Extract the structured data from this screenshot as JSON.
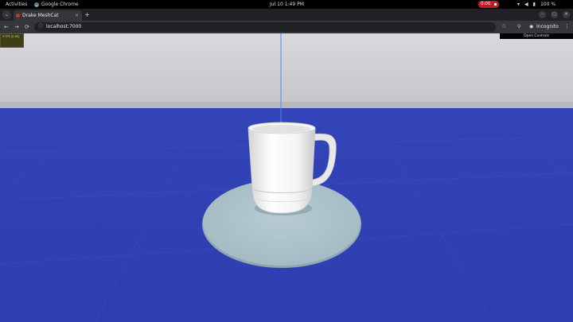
{
  "system_bar": {
    "activities": "Activities",
    "app_name": "Google Chrome",
    "clock": "Jul 10  1:49 PM",
    "recording_time": "0:00",
    "battery": "100 %"
  },
  "browser": {
    "tab_title": "Drake MeshCat",
    "url": "localhost:7000",
    "incognito_label": "Incognito",
    "new_tab": "+",
    "tab_close": "×",
    "tab_menu": "⌄",
    "back": "←",
    "forward": "→",
    "reload": "⟳",
    "menu": "⋮",
    "minimize": "–",
    "maximize": "▢",
    "close": "✕"
  },
  "meshcat": {
    "open_controls": "Open Controls",
    "stats_text": "0 FPS (0-60)"
  },
  "scene": {
    "sky_color": "#d9d8dd",
    "ground_color": "#3041b3",
    "plate_color": "#a8c0c8",
    "mug_color": "#f1f1f1",
    "axis_color": "#4a8cf0"
  }
}
